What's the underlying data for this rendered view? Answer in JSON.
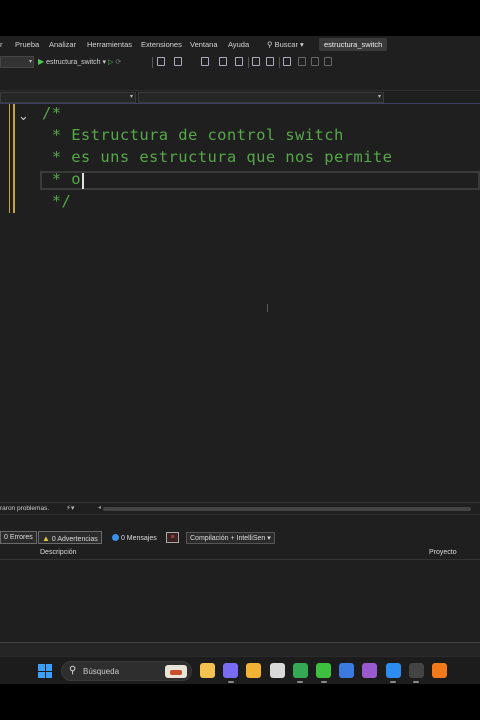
{
  "menu": {
    "items": [
      "r",
      "Prueba",
      "Analizar",
      "Herramientas",
      "Extensiones",
      "Ventana",
      "Ayuda"
    ],
    "search_label": "Buscar",
    "solution_name": "estructura_switch"
  },
  "toolbar": {
    "run_target": "estructura_switch"
  },
  "editor": {
    "lines": [
      "/*",
      " * Estructura de control switch",
      " * es uns estructura que nos permite",
      " * o",
      " */"
    ]
  },
  "status": {
    "message": "raron problemas."
  },
  "error_list": {
    "errors": "0 Errores",
    "warnings": "0 Advertencias",
    "messages": "0 Mensajes",
    "build_filter": "Compilación + IntelliSen",
    "columns": {
      "description": "Descripción",
      "project": "Proyecto"
    }
  },
  "taskbar": {
    "search_placeholder": "Búsqueda",
    "apps": [
      {
        "icon": "file-explorer-icon",
        "color": "#f2c14e"
      },
      {
        "icon": "copilot-icon",
        "color": "#7a6cf0"
      },
      {
        "icon": "folder-icon",
        "color": "#f2b233"
      },
      {
        "icon": "package-icon",
        "color": "#d9d9d9"
      },
      {
        "icon": "chrome-icon",
        "color": "#34a853"
      },
      {
        "icon": "codeblocks-icon",
        "color": "#3fbf3f"
      },
      {
        "icon": "pencil-app-icon",
        "color": "#3b7be0"
      },
      {
        "icon": "github-desktop-icon",
        "color": "#9b59d0"
      },
      {
        "icon": "vscode-icon",
        "color": "#2d8cf0"
      },
      {
        "icon": "terminal-icon",
        "color": "#444444"
      },
      {
        "icon": "xampp-icon",
        "color": "#f07a1a"
      }
    ]
  }
}
